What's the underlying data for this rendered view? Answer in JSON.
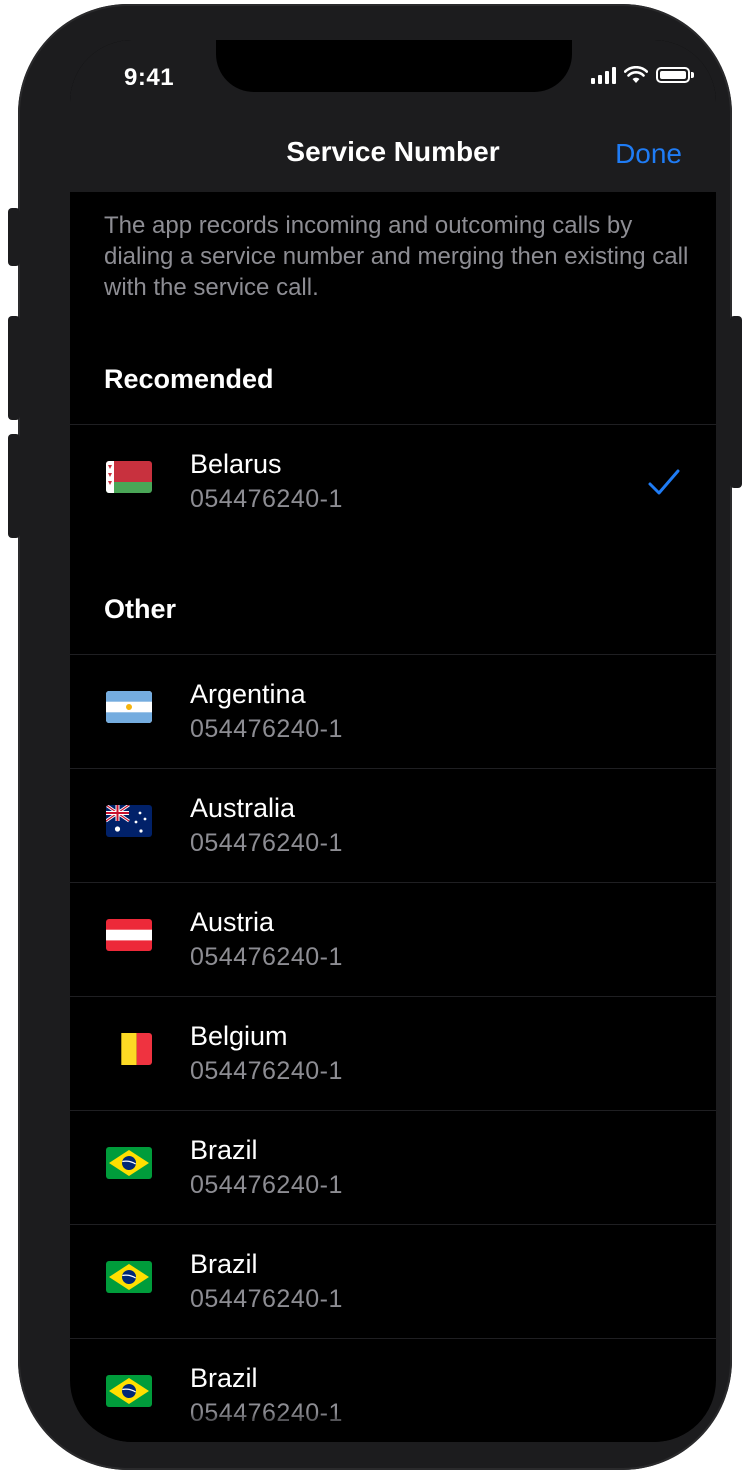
{
  "status_bar": {
    "time": "9:41"
  },
  "nav": {
    "title": "Service Number",
    "done_label": "Done"
  },
  "description": "The app records incoming and outcoming calls by dialing a service number and merging then existing call with the service call.",
  "sections": {
    "recommended": {
      "header": "Recomended",
      "items": [
        {
          "name": "Belarus",
          "number": "054476240-1",
          "flag": "belarus-flag",
          "selected": true
        }
      ]
    },
    "other": {
      "header": "Other",
      "items": [
        {
          "name": "Argentina",
          "number": "054476240-1",
          "flag": "argentina-flag"
        },
        {
          "name": "Australia",
          "number": "054476240-1",
          "flag": "australia-flag"
        },
        {
          "name": "Austria",
          "number": "054476240-1",
          "flag": "austria-flag"
        },
        {
          "name": "Belgium",
          "number": "054476240-1",
          "flag": "belgium-flag"
        },
        {
          "name": "Brazil",
          "number": "054476240-1",
          "flag": "brazil-flag"
        },
        {
          "name": "Brazil",
          "number": "054476240-1",
          "flag": "brazil-flag"
        },
        {
          "name": "Brazil",
          "number": "054476240-1",
          "flag": "brazil-flag"
        }
      ]
    }
  },
  "colors": {
    "accent": "#1f7cf5",
    "background": "#000000",
    "bar_background": "#1c1c1e",
    "secondary_text": "#8d8d93"
  }
}
